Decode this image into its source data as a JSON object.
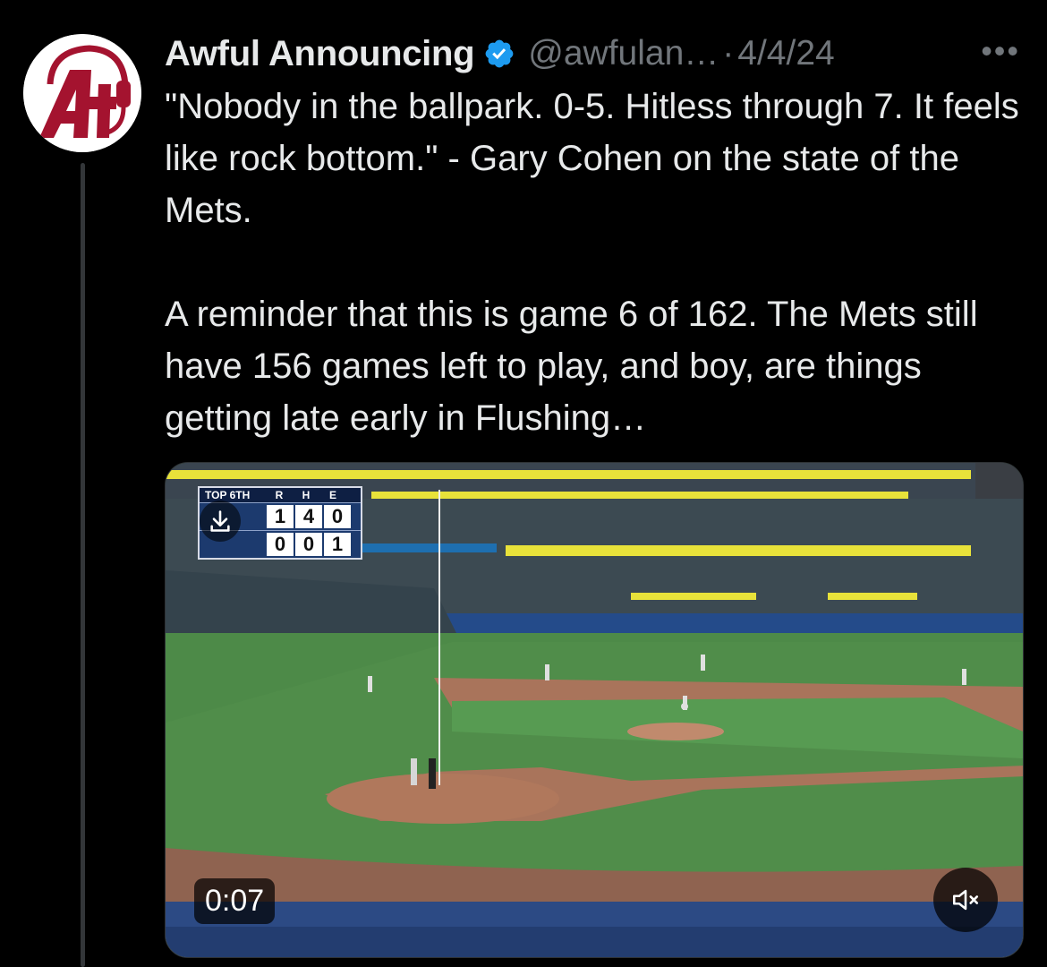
{
  "tweet": {
    "author_name": "Awful Announcing",
    "handle": "@awfulan…",
    "separator": "·",
    "date": "4/4/24",
    "more_label": "•••",
    "paragraphs": [
      "\"Nobody in the ballpark. 0-5. Hitless through 7. It feels like rock bottom.\" - Gary Cohen on the state of the Mets.",
      "A reminder that this is game 6 of 162. The Mets still have 156 games left to play, and boy, are things getting late early in Flushing…"
    ]
  },
  "video": {
    "elapsed_time": "0:07",
    "scorebug": {
      "inning": "TOP 6TH",
      "headers": [
        "R",
        "H",
        "E"
      ],
      "away_values": [
        "1",
        "4",
        "0"
      ],
      "home_values": [
        "0",
        "0",
        "1"
      ]
    }
  },
  "colors": {
    "background": "#000000",
    "text_primary": "#e7e9ea",
    "text_secondary": "#71767b",
    "verified_blue": "#1d9bf0",
    "avatar_red": "#a4132f"
  },
  "icons": {
    "verified": "verified-badge-icon",
    "download": "download-icon",
    "mute": "volume-muted-icon",
    "more": "more-horizontal-icon"
  }
}
